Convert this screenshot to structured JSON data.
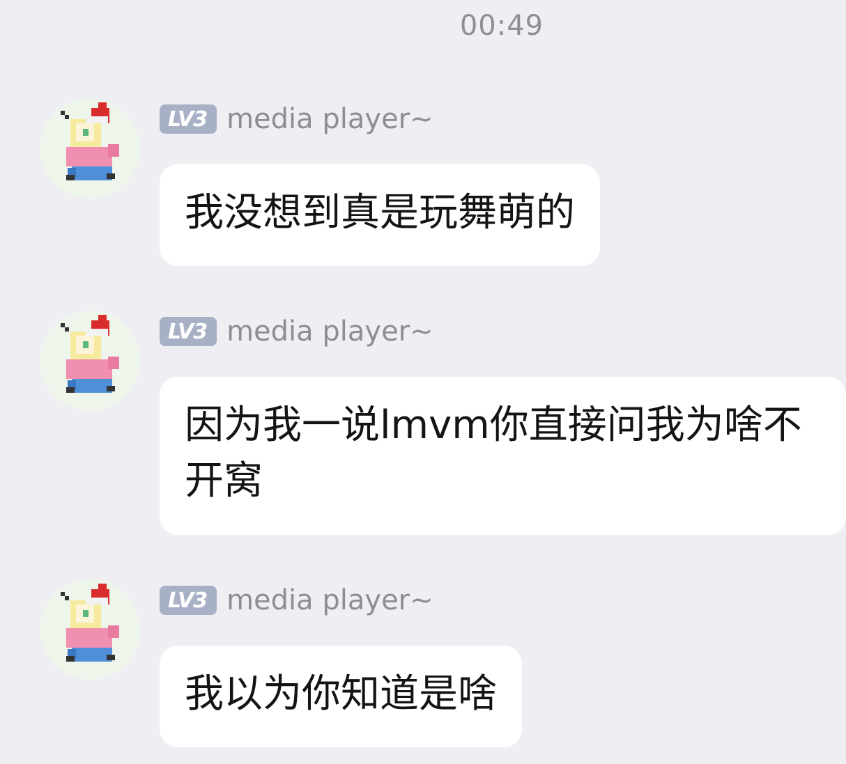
{
  "chat": {
    "timestamp": "00:49",
    "messages": [
      {
        "level": "LV3",
        "sender": "media player~",
        "text": "我没想到真是玩舞萌的"
      },
      {
        "level": "LV3",
        "sender": "media player~",
        "text": "因为我一说lmvm你直接问我为啥不开窝"
      },
      {
        "level": "LV3",
        "sender": "media player~",
        "text": "我以为你知道是啥"
      }
    ]
  },
  "colors": {
    "background": "#eeeef3",
    "bubble": "#ffffff",
    "badge": "#a8b0c6",
    "sender_text": "#8d8e95",
    "timestamp_text": "#8e8e96"
  },
  "icons": {
    "avatar": "pixel-character-avatar-icon"
  }
}
